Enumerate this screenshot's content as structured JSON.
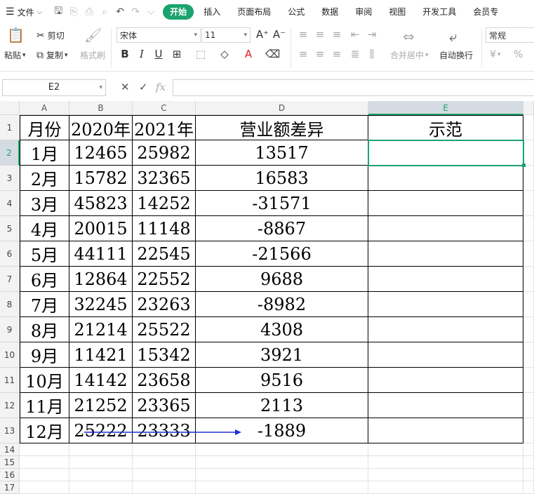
{
  "menubar": {
    "file_label": "文件",
    "tabs": [
      "开始",
      "插入",
      "页面布局",
      "公式",
      "数据",
      "审阅",
      "视图",
      "开发工具",
      "会员专"
    ]
  },
  "ribbon": {
    "paste_label": "粘贴",
    "cut_label": "剪切",
    "copy_label": "复制",
    "format_painter_label": "格式刷",
    "font_name": "宋体",
    "font_size": "11",
    "merge_label": "合并居中",
    "wrap_label": "自动换行",
    "number_format": "常规",
    "currency_symbol": "¥",
    "percent_symbol": "%"
  },
  "formula_bar": {
    "name_box": "E2",
    "fx_label": "fx",
    "value": ""
  },
  "sheet": {
    "columns": [
      "A",
      "B",
      "C",
      "D",
      "E"
    ],
    "row_numbers": [
      "1",
      "2",
      "3",
      "4",
      "5",
      "6",
      "7",
      "8",
      "9",
      "10",
      "11",
      "12",
      "13",
      "14",
      "15",
      "16",
      "17"
    ],
    "selected_cell": "E2",
    "header_row": [
      "月份",
      "2020年",
      "2021年",
      "营业额差异",
      "示范"
    ],
    "rows": [
      [
        "1月",
        "12465",
        "25982",
        "13517",
        ""
      ],
      [
        "2月",
        "15782",
        "32365",
        "16583",
        ""
      ],
      [
        "3月",
        "45823",
        "14252",
        "-31571",
        ""
      ],
      [
        "4月",
        "20015",
        "11148",
        "-8867",
        ""
      ],
      [
        "5月",
        "44111",
        "22545",
        "-21566",
        ""
      ],
      [
        "6月",
        "12864",
        "22552",
        "9688",
        ""
      ],
      [
        "7月",
        "32245",
        "23263",
        "-8982",
        ""
      ],
      [
        "8月",
        "21214",
        "25522",
        "4308",
        ""
      ],
      [
        "9月",
        "11421",
        "15342",
        "3921",
        ""
      ],
      [
        "10月",
        "14142",
        "23658",
        "9516",
        ""
      ],
      [
        "11月",
        "21252",
        "23365",
        "2113",
        ""
      ],
      [
        "12月",
        "25222",
        "23333",
        "-1889",
        ""
      ]
    ]
  },
  "colors": {
    "accent": "#1aa36f",
    "annotation_arrow": "#1f2fd6"
  }
}
